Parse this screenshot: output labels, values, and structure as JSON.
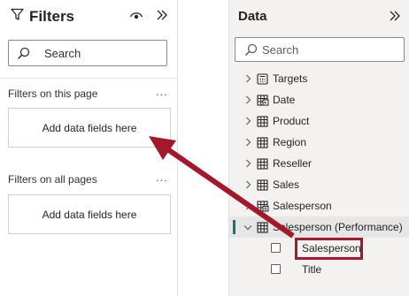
{
  "filters_pane": {
    "title": "Filters",
    "icons": [
      "filter-funnel-icon",
      "eye-icon",
      "collapse-chevrons-icon"
    ],
    "search_placeholder": "Search",
    "sections": [
      {
        "label": "Filters on this page",
        "more": "...",
        "drop_text": "Add data fields here"
      },
      {
        "label": "Filters on all pages",
        "more": "...",
        "drop_text": "Add data fields here"
      }
    ]
  },
  "data_pane": {
    "title": "Data",
    "search_placeholder": "Search",
    "tables": [
      {
        "name": "Targets",
        "icon": "calculator-table-icon",
        "expanded": false
      },
      {
        "name": "Date",
        "icon": "date-table-icon",
        "expanded": false
      },
      {
        "name": "Product",
        "icon": "table-icon",
        "expanded": false
      },
      {
        "name": "Region",
        "icon": "table-icon",
        "expanded": false
      },
      {
        "name": "Reseller",
        "icon": "table-icon",
        "expanded": false
      },
      {
        "name": "Sales",
        "icon": "table-icon",
        "expanded": false
      },
      {
        "name": "Salesperson",
        "icon": "hierarchy-table-icon",
        "expanded": false
      },
      {
        "name": "Salesperson (Performance)",
        "icon": "table-icon",
        "expanded": true,
        "selected": true,
        "fields": [
          {
            "name": "Salesperson",
            "checked": false,
            "highlighted": true
          },
          {
            "name": "Title",
            "checked": false,
            "highlighted": false
          }
        ]
      }
    ]
  },
  "annotation": {
    "color": "#a4182b",
    "type": "drag-arrow"
  }
}
